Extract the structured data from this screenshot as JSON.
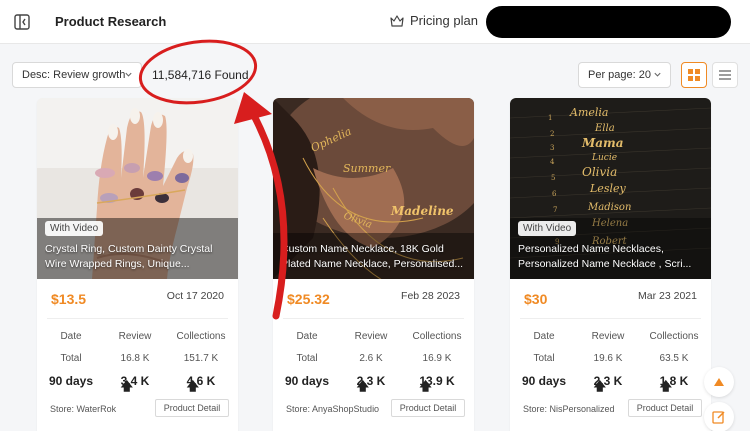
{
  "header": {
    "title": "Product Research",
    "pricing_label": "Pricing plan"
  },
  "toolbar": {
    "sort_value": "Desc: Review growth",
    "found_text": "11,584,716 Found",
    "per_page_value": "Per page: 20"
  },
  "cards": [
    {
      "badge": "With Video",
      "title_line1": "Crystal Ring, Custom Dainty Crystal",
      "title_line2": "Wire Wrapped Rings, Unique...",
      "price": "$13.5",
      "date": "Oct 17 2020",
      "head": [
        "Date",
        "Review",
        "Collections"
      ],
      "total": [
        "Total",
        "16.8 K",
        "151.7 K"
      ],
      "days": [
        "90 days",
        "3.4 K",
        "4.6 K"
      ],
      "store": "Store: WaterRok",
      "detail_label": "Product Detail"
    },
    {
      "badge": "",
      "title_line1": "Custom Name Necklace, 18K Gold",
      "title_line2": "Plated Name Necklace, Personalised...",
      "price": "$25.32",
      "date": "Feb 28 2023",
      "head": [
        "Date",
        "Review",
        "Collections"
      ],
      "total": [
        "Total",
        "2.6 K",
        "16.9 K"
      ],
      "days": [
        "90 days",
        "2.3 K",
        "13.9 K"
      ],
      "store": "Store: AnyaShopStudio",
      "detail_label": "Product Detail"
    },
    {
      "badge": "With Video",
      "title_line1": "Personalized Name Necklaces,",
      "title_line2": "Personalized Name Necklace , Scri...",
      "price": "$30",
      "date": "Mar 23 2021",
      "head": [
        "Date",
        "Review",
        "Collections"
      ],
      "total": [
        "Total",
        "19.6 K",
        "63.5 K"
      ],
      "days": [
        "90 days",
        "2.3 K",
        "1.8 K"
      ],
      "store": "Store: NisPersonalized",
      "detail_label": "Product Detail"
    }
  ],
  "necklace_names": [
    "Amelia",
    "Ella",
    "Mama",
    "Lucie",
    "Olivia",
    "Lesley",
    "Madison",
    "Helena",
    "Robert"
  ],
  "card2_image_names": [
    "Ophelia",
    "Summer",
    "Madeline",
    "Olivia"
  ],
  "colors": {
    "accent": "#f08a24",
    "annotation_red": "#d81e1e"
  }
}
